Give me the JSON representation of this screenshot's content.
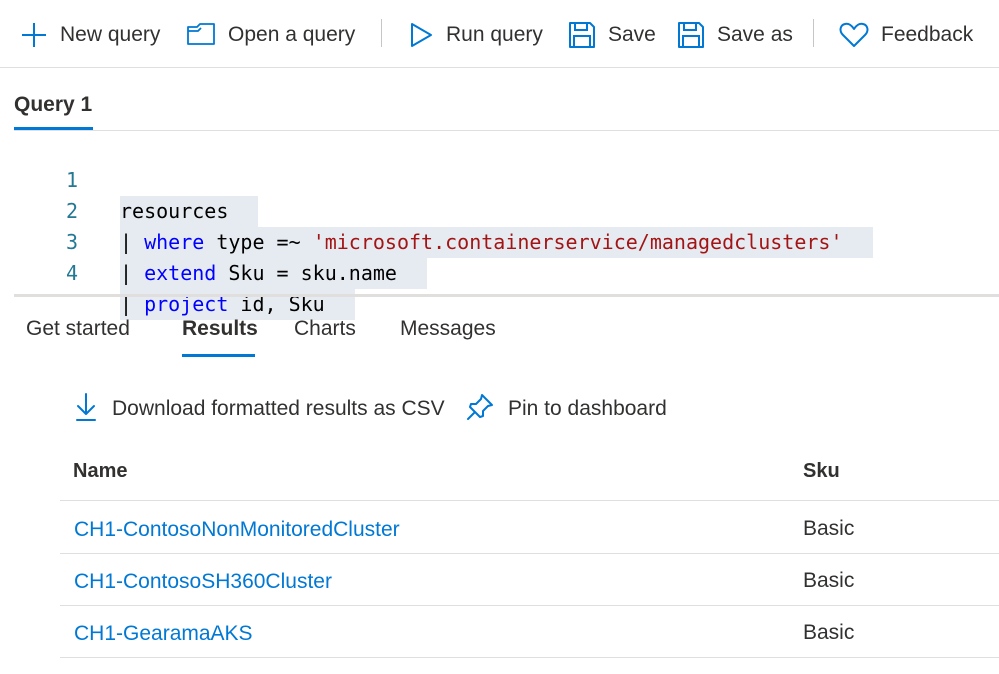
{
  "toolbar": {
    "new_query": {
      "label": "New query",
      "icon": "plus-icon"
    },
    "open_query": {
      "label": "Open a query",
      "icon": "folder-icon"
    },
    "run_query": {
      "label": "Run query",
      "icon": "play-icon"
    },
    "save": {
      "label": "Save",
      "icon": "save-icon"
    },
    "save_as": {
      "label": "Save as",
      "icon": "save-as-icon"
    },
    "feedback": {
      "label": "Feedback",
      "icon": "heart-icon"
    }
  },
  "query_tab": {
    "label": "Query 1"
  },
  "editor": {
    "lines": [
      {
        "number": "1",
        "tokens": [
          {
            "text": "resources",
            "kind": "plain"
          }
        ]
      },
      {
        "number": "2",
        "tokens": [
          {
            "text": "| ",
            "kind": "plain"
          },
          {
            "text": "where",
            "kind": "keyword"
          },
          {
            "text": " type =~ ",
            "kind": "plain"
          },
          {
            "text": "'microsoft.containerservice/managedclusters'",
            "kind": "string"
          }
        ]
      },
      {
        "number": "3",
        "tokens": [
          {
            "text": "| ",
            "kind": "plain"
          },
          {
            "text": "extend",
            "kind": "keyword"
          },
          {
            "text": " Sku = sku.name",
            "kind": "plain"
          }
        ]
      },
      {
        "number": "4",
        "tokens": [
          {
            "text": "| ",
            "kind": "plain"
          },
          {
            "text": "project",
            "kind": "keyword"
          },
          {
            "text": " id, Sku",
            "kind": "plain"
          }
        ]
      }
    ]
  },
  "result_tabs": [
    {
      "label": "Get started",
      "active": false
    },
    {
      "label": "Results",
      "active": true
    },
    {
      "label": "Charts",
      "active": false
    },
    {
      "label": "Messages",
      "active": false
    }
  ],
  "actions": {
    "download": {
      "label": "Download formatted results as CSV",
      "icon": "download-icon"
    },
    "pin": {
      "label": "Pin to dashboard",
      "icon": "pin-icon"
    }
  },
  "table": {
    "columns": [
      "Name",
      "Sku"
    ],
    "rows": [
      {
        "name": "CH1-ContosoNonMonitoredCluster",
        "sku": "Basic"
      },
      {
        "name": "CH1-ContosoSH360Cluster",
        "sku": "Basic"
      },
      {
        "name": "CH1-GearamaAKS",
        "sku": "Basic"
      }
    ]
  },
  "colors": {
    "accent": "#0078d4",
    "keyword": "#0000ff",
    "string": "#a31515",
    "line_number": "#237893",
    "selection": "#e6ebf1"
  }
}
